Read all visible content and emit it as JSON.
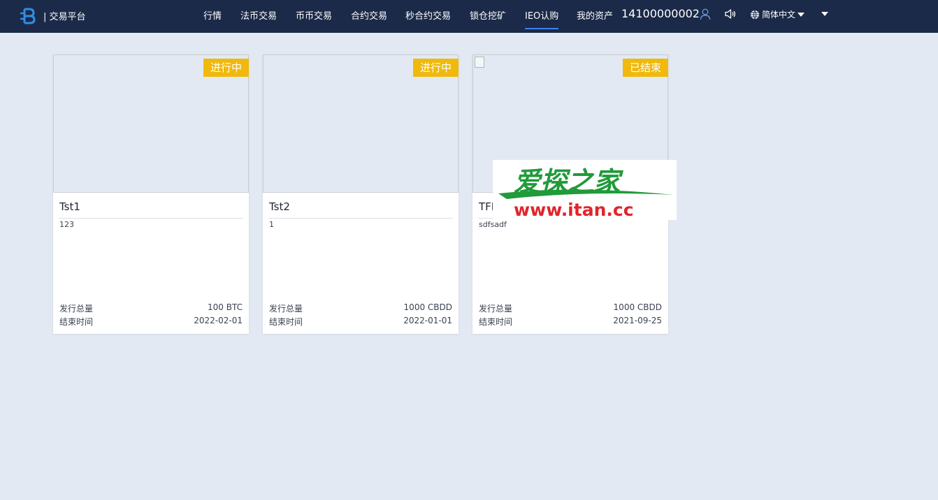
{
  "header": {
    "brand": "| 交易平台",
    "nav": [
      {
        "label": "行情",
        "active": false
      },
      {
        "label": "法币交易",
        "active": false
      },
      {
        "label": "币币交易",
        "active": false
      },
      {
        "label": "合约交易",
        "active": false
      },
      {
        "label": "秒合约交易",
        "active": false
      },
      {
        "label": "锁仓挖矿",
        "active": false
      },
      {
        "label": "IEO认购",
        "active": true
      },
      {
        "label": "我的资产",
        "active": false
      }
    ],
    "phone": "14100000002",
    "language": "简体中文",
    "icons": [
      "user-icon",
      "speaker-icon",
      "globe-icon",
      "caret-down-icon"
    ]
  },
  "cards": [
    {
      "status": "进行中",
      "title": "Tst1",
      "desc": "123",
      "total_label": "发行总量",
      "total_value": "100 BTC",
      "end_label": "结束时间",
      "end_value": "2022-02-01",
      "broken_image": false
    },
    {
      "status": "进行中",
      "title": "Tst2",
      "desc": "1",
      "total_label": "发行总量",
      "total_value": "1000 CBDD",
      "end_label": "结束时间",
      "end_value": "2022-01-01",
      "broken_image": false
    },
    {
      "status": "已结束",
      "title": "TFI",
      "desc": "sdfsadf",
      "total_label": "发行总量",
      "total_value": "1000 CBDD",
      "end_label": "结束时间",
      "end_value": "2021-09-25",
      "broken_image": true
    }
  ],
  "watermark": {
    "text_cn": "爱探之家",
    "text_url": "www.itan.cc"
  },
  "colors": {
    "header_bg": "#1b2a48",
    "page_bg": "#e3e9f3",
    "badge": "#f0b90b",
    "active_underline": "#3b82f6",
    "logo": "#2f8fe6",
    "watermark_green": "#1f9b3a",
    "watermark_red": "#e0252b"
  }
}
